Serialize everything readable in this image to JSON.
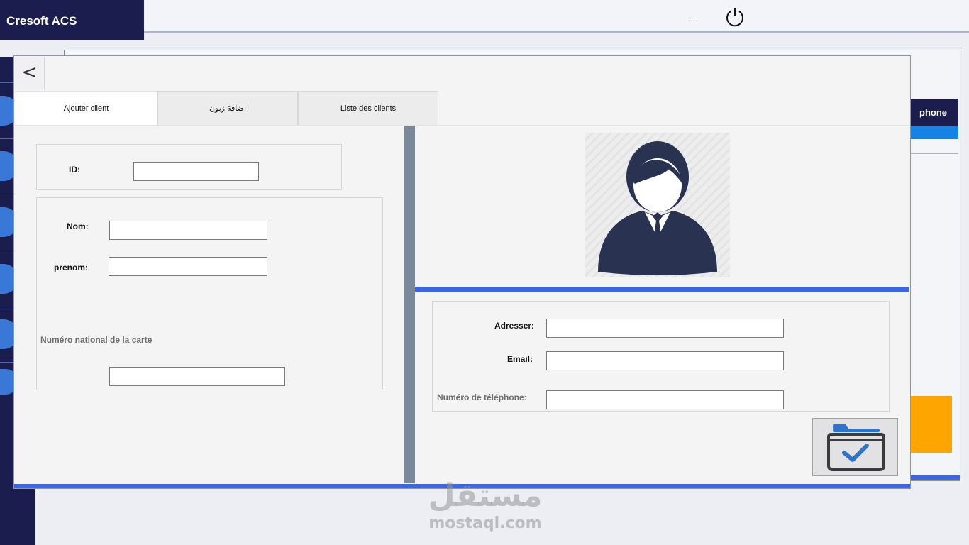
{
  "app": {
    "title": "Cresoft ACS",
    "minimize_label": "_"
  },
  "background": {
    "column_header_partial": "phone"
  },
  "dialog": {
    "back_label": "<",
    "tabs": [
      {
        "label": "Ajouter client",
        "active": true
      },
      {
        "label": "اضافة زبون",
        "active": false
      },
      {
        "label": "Liste des clients",
        "active": false
      }
    ],
    "fields": {
      "id": {
        "label": "ID:",
        "value": ""
      },
      "nom": {
        "label": "Nom:",
        "value": ""
      },
      "prenom": {
        "label": "prenom:",
        "value": ""
      },
      "national_card": {
        "label": "Numéro national de la carte",
        "value": ""
      },
      "address": {
        "label": "Adresser:",
        "value": ""
      },
      "email": {
        "label": "Email:",
        "value": ""
      },
      "phone": {
        "label": "Numéro de téléphone:",
        "value": ""
      }
    }
  },
  "watermark": {
    "arabic": "مستقل",
    "latin": "mostaql.com"
  },
  "colors": {
    "sidebar_navy": "#1b1d4e",
    "accent_blue": "#3c66e2",
    "avatar_navy": "#2a3252",
    "orange": "#ffa500"
  }
}
